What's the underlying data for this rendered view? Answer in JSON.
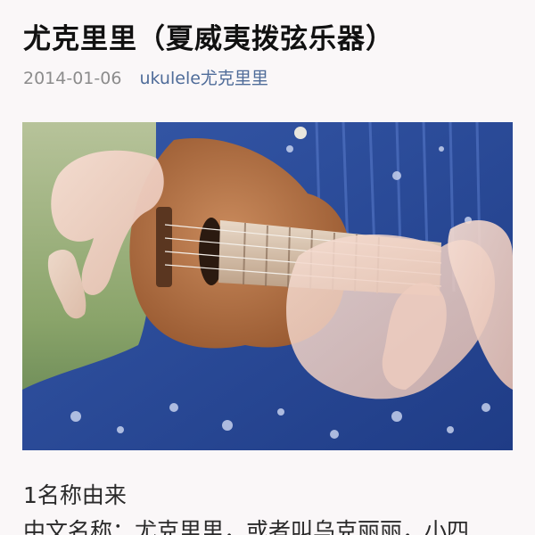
{
  "article": {
    "title": "尤克里里（夏威夷拨弦乐器）",
    "date": "2014-01-06",
    "author": "ukulele尤克里里",
    "hero_image_icon": "ukulele-photo",
    "section_heading": "1名称由来",
    "body_first_line": "中文名称：尤克里里，或者叫乌克丽丽，小四"
  },
  "colors": {
    "background": "#faf7f8",
    "title": "#111111",
    "date": "#8c8c8c",
    "author_link": "#4f6c99",
    "body_text": "#2a2a2a"
  }
}
